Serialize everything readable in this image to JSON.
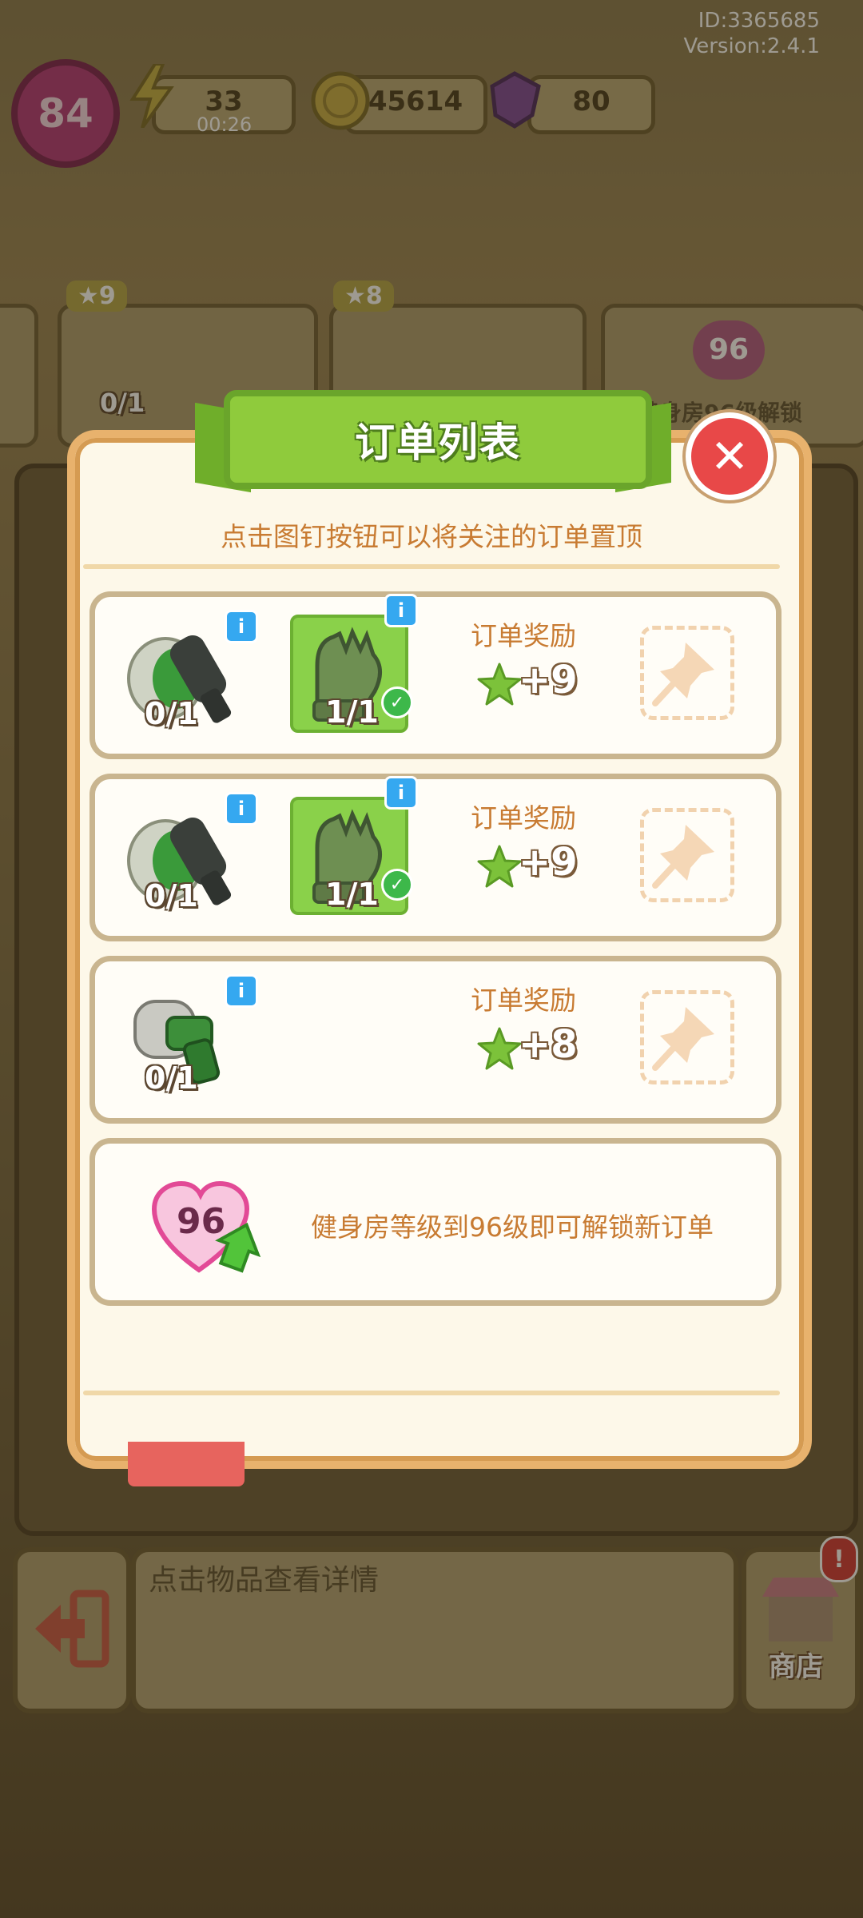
{
  "hud": {
    "id_text": "ID:3365685",
    "version_text": "Version:2.4.1",
    "level": "84",
    "energy": "33",
    "energy_timer": "00:26",
    "coins": "45614",
    "gems": "80"
  },
  "background_strip": {
    "order1_star": "9",
    "order1_count": "0/1",
    "order2_star": "8",
    "lock_level": "96",
    "lock_text": "健身房96级解锁"
  },
  "popup": {
    "title": "订单列表",
    "hint": "点击图钉按钮可以将关注的订单置顶",
    "orders": [
      {
        "items": [
          {
            "icon": "rope-fitness-tool",
            "count": "0/1"
          },
          {
            "icon": "green-gloves",
            "count": "1/1"
          }
        ],
        "reward_label": "订单奖励",
        "reward": "+9"
      },
      {
        "items": [
          {
            "icon": "rope-fitness-tool",
            "count": "0/1"
          },
          {
            "icon": "green-gloves",
            "count": "1/1"
          }
        ],
        "reward_label": "订单奖励",
        "reward": "+9"
      },
      {
        "items": [
          {
            "icon": "foam-roller-drill",
            "count": "0/1"
          }
        ],
        "reward_label": "订单奖励",
        "reward": "+8"
      }
    ],
    "locked": {
      "level": "96",
      "text": "健身房等级到96级即可解锁新订单"
    }
  },
  "bottom_bar": {
    "detail_placeholder": "点击物品查看详情",
    "shop_label": "商店",
    "alert": "!"
  },
  "colors": {
    "popup_bg": "#fdf8e9",
    "ribbon_green": "#8fcb3c",
    "hint_orange": "#c87b32",
    "close_red": "#e84848"
  }
}
